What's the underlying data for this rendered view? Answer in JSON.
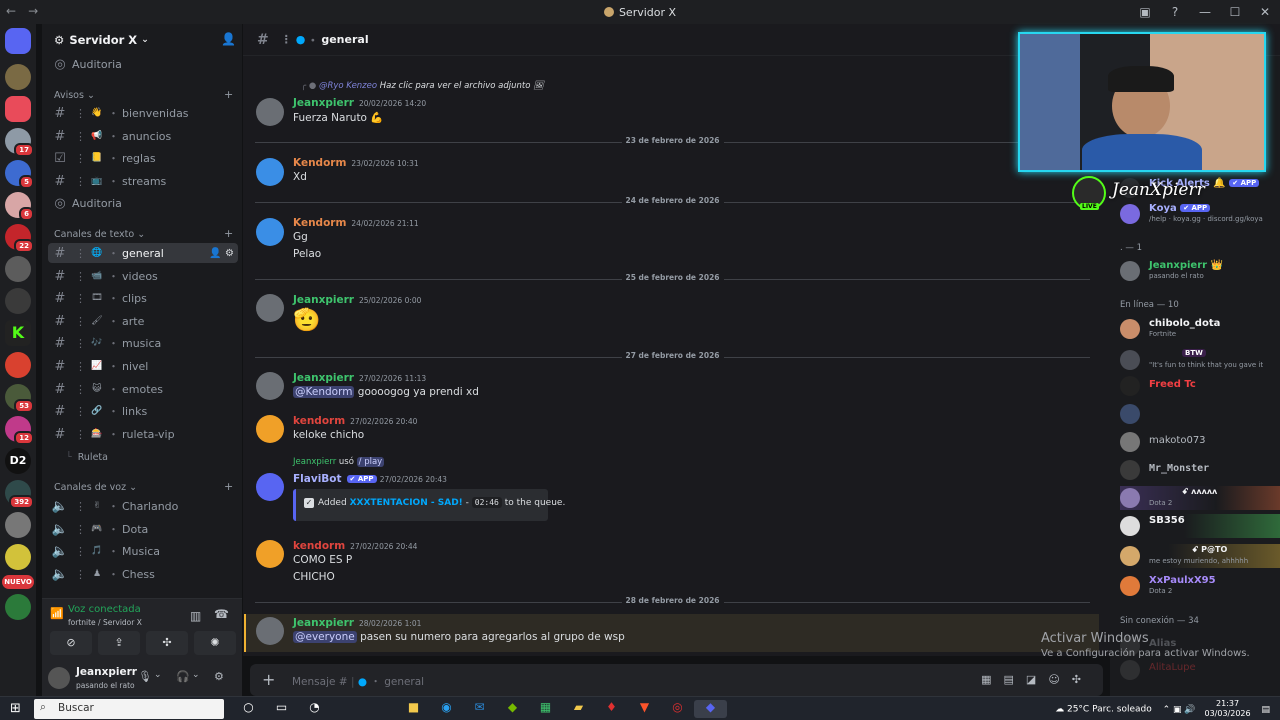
{
  "window": {
    "title": "Servidor X"
  },
  "server": {
    "name": "Servidor X"
  },
  "sidebar": {
    "top_item": "Auditoria",
    "categories": {
      "avisos": "Avisos",
      "texto": "Canales de texto",
      "voz": "Canales de voz"
    },
    "avisos_channels": [
      {
        "emoji": "👋",
        "name": "bienvenidas"
      },
      {
        "emoji": "📢",
        "name": "anuncios"
      },
      {
        "emoji": "📒",
        "name": "reglas"
      },
      {
        "emoji": "📺",
        "name": "streams"
      }
    ],
    "forum_item": "Auditoria",
    "text_channels": [
      {
        "emoji": "🌐",
        "name": "general"
      },
      {
        "emoji": "📹",
        "name": "videos"
      },
      {
        "emoji": "🎞",
        "name": "clips"
      },
      {
        "emoji": "🖌",
        "name": "arte"
      },
      {
        "emoji": "🎶",
        "name": "musica"
      },
      {
        "emoji": "📈",
        "name": "nivel"
      },
      {
        "emoji": "😺",
        "name": "emotes"
      },
      {
        "emoji": "🔗",
        "name": "links"
      },
      {
        "emoji": "🎰",
        "name": "ruleta-vip"
      }
    ],
    "thread": "Ruleta",
    "voice_channels": [
      {
        "emoji": "✌",
        "name": "Charlando"
      },
      {
        "emoji": "🎮",
        "name": "Dota"
      },
      {
        "emoji": "🎵",
        "name": "Musica"
      },
      {
        "emoji": "♟",
        "name": "Chess"
      }
    ]
  },
  "voice": {
    "status": "Voz conectada",
    "location": "fortnite / Servidor X"
  },
  "user": {
    "name": "Jeanxpierr",
    "status": "pasando el rato"
  },
  "guild_badges": [
    "17",
    "5",
    "6",
    "22",
    "53",
    "12",
    "392"
  ],
  "guild_labels": {
    "d2": "D2",
    "new": "NUEVO"
  },
  "chat": {
    "channel": "general",
    "reply_preview": {
      "user": "@Ryo Kenzeo",
      "text": "Haz clic para ver el archivo adjunto"
    },
    "messages": [
      {
        "author": "Jeanxpierr",
        "time": "20/02/2026 14:20",
        "lines": [
          "Fuerza Naruto 💪"
        ]
      },
      {
        "author": "Kendorm",
        "time": "23/02/2026 10:31",
        "lines": [
          "Xd"
        ]
      },
      {
        "author": "Kendorm",
        "time": "24/02/2026 21:11",
        "lines": [
          "Gg",
          "Pelao"
        ]
      },
      {
        "author": "Jeanxpierr",
        "time": "25/02/2026 0:00",
        "lines": [
          "🫡"
        ]
      },
      {
        "author": "Jeanxpierr",
        "time": "27/02/2026 11:13",
        "mention": "@Kendorm",
        "lines": [
          "goooogog  ya prendi xd"
        ]
      },
      {
        "author": "kendorm",
        "time": "27/02/2026 20:40",
        "lines": [
          "keloke chicho"
        ]
      },
      {
        "author": "FlaviBot",
        "tag": "✔ APP",
        "time": "27/02/2026 20:43",
        "used_by": "Jeanxpierr",
        "used_text": "usó",
        "command": "/ play"
      },
      {
        "author": "kendorm",
        "time": "27/02/2026 20:44",
        "lines": [
          "COMO ES P",
          "CHICHO"
        ]
      },
      {
        "author": "Jeanxpierr",
        "time": "28/02/2026 1:01",
        "mention": "@everyone",
        "lines": [
          "pasen su numero para agregarlos al grupo de wsp"
        ]
      }
    ],
    "embed": {
      "prefix": "Added",
      "song": "XXXTENTACION - SAD!",
      "dash": "-",
      "duration": "02:46",
      "suffix": "to the queue."
    },
    "dates": [
      "23 de febrero de 2026",
      "24 de febrero de 2026",
      "25 de febrero de 2026",
      "27 de febrero de 2026",
      "28 de febrero de 2026"
    ],
    "composer_placeholder": "Mensaje #",
    "composer_channel": "general"
  },
  "members": {
    "bots": [
      {
        "name": "Kick Alerts 🔔",
        "tag": "✔ APP"
      },
      {
        "name": "Koya",
        "tag": "✔ APP",
        "status": "/help · koya.gg · discord.gg/koya"
      }
    ],
    "role_header": ". — 1",
    "role_member": {
      "name": "Jeanxpierr 👑",
      "status": "pasando el rato"
    },
    "online_header": "En línea — 10",
    "online": [
      {
        "name": "chibolo_dota",
        "status": "Fortnite",
        "color": "#f2f3f5"
      },
      {
        "name": "",
        "status": "\"It's fun to think that you gave it",
        "tag": "BTW",
        "color": "#f2f3f5"
      },
      {
        "name": "Freed Tc",
        "status": "",
        "color": "#f23f43"
      },
      {
        "name": "",
        "status": "",
        "color": "#f2f3f5"
      },
      {
        "name": "makoto073",
        "status": "",
        "color": "#b5bac1"
      },
      {
        "name": "Mr_Monster",
        "status": "",
        "color": "#b5bac1"
      },
      {
        "name": "ꗃ ʌʌʌʌʌ",
        "status": "Dota 2",
        "color": "#f2f3f5"
      },
      {
        "name": "SB356",
        "status": "",
        "color": "#f2f3f5"
      },
      {
        "name": "ꗃ P@TO",
        "status": "me estoy muriendo, ahhhhh",
        "color": "#f2f3f5"
      },
      {
        "name": "XxPaulxX95",
        "status": "Dota 2",
        "color": "#a78bfa"
      }
    ],
    "offline_header": "Sin conexión — 34",
    "offline": [
      "Alias",
      "AlitaLupe"
    ]
  },
  "stream": {
    "overlay_name": "JeanXpierr",
    "live": "LIVE"
  },
  "windows_watermark": {
    "title": "Activar Windows",
    "subtitle": "Ve a Configuración para activar Windows."
  },
  "taskbar": {
    "search": "Buscar",
    "weather": "25°C  Parc. soleado",
    "time": "21:37",
    "date": "03/03/2026",
    "lang": "ESP"
  }
}
